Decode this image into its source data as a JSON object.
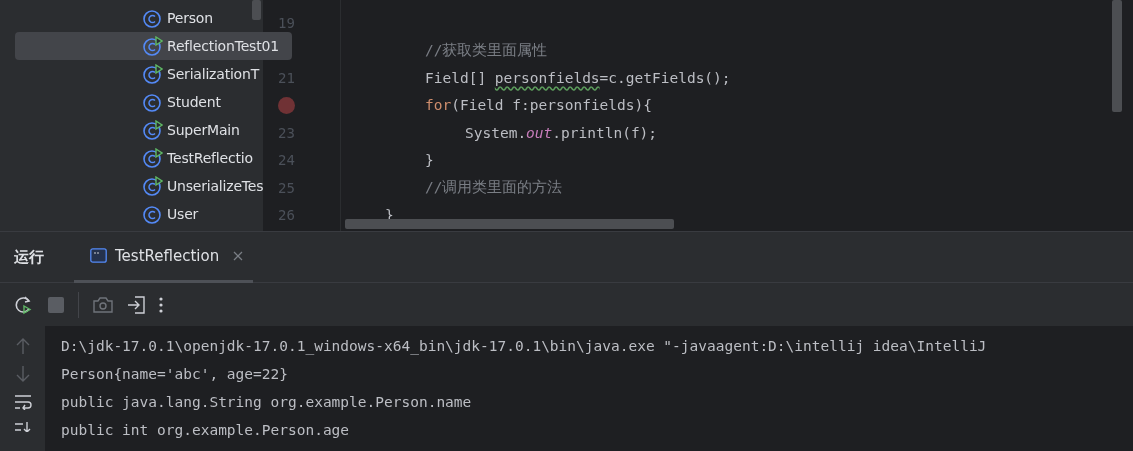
{
  "project_tree": {
    "items": [
      {
        "label": "Person",
        "kind": "class",
        "selected": false
      },
      {
        "label": "ReflectionTest01",
        "kind": "runnable",
        "selected": true
      },
      {
        "label": "SerializationT",
        "kind": "runnable",
        "selected": false
      },
      {
        "label": "Student",
        "kind": "class",
        "selected": false
      },
      {
        "label": "SuperMain",
        "kind": "runnable",
        "selected": false
      },
      {
        "label": "TestReflectio",
        "kind": "runnable",
        "selected": false
      },
      {
        "label": "UnserializeTes",
        "kind": "runnable",
        "selected": false
      },
      {
        "label": "User",
        "kind": "class",
        "selected": false
      }
    ]
  },
  "editor": {
    "lines": [
      {
        "number": "19"
      },
      {
        "tokens": [
          {
            "text": "//获取类里面属性",
            "kind": "comment"
          }
        ]
      },
      {
        "number": "21",
        "tokens": [
          {
            "text": "Field[] ",
            "kind": "plain"
          },
          {
            "text": "personfields",
            "kind": "warn"
          },
          {
            "text": "=c.getFields();",
            "kind": "plain"
          }
        ]
      },
      {
        "breakpoint": true,
        "tokens": [
          {
            "text": "for",
            "kind": "keyword"
          },
          {
            "text": "(Field f:personfields){",
            "kind": "plain"
          }
        ]
      },
      {
        "number": "23",
        "indent": true,
        "tokens": [
          {
            "text": "System.",
            "kind": "plain"
          },
          {
            "text": "out",
            "kind": "field"
          },
          {
            "text": ".println(f);",
            "kind": "plain"
          }
        ]
      },
      {
        "number": "24",
        "tokens": [
          {
            "text": "}",
            "kind": "plain"
          }
        ]
      },
      {
        "number": "25",
        "tokens": [
          {
            "text": "//调用类里面的方法",
            "kind": "comment"
          }
        ]
      },
      {
        "number": "26",
        "outer": true,
        "tokens": [
          {
            "text": "}",
            "kind": "plain"
          }
        ]
      }
    ]
  },
  "run_panel": {
    "title": "运行",
    "tabs": [
      {
        "label": "TestReflection",
        "selected": true
      }
    ],
    "toolbar": [
      {
        "kind": "rerun",
        "disabled": false
      },
      {
        "kind": "stop",
        "disabled": true
      },
      {
        "kind": "separator"
      },
      {
        "kind": "camera",
        "disabled": true
      },
      {
        "kind": "exit",
        "disabled": false
      },
      {
        "kind": "more",
        "disabled": false
      }
    ],
    "console": [
      "D:\\jdk-17.0.1\\openjdk-17.0.1_windows-x64_bin\\jdk-17.0.1\\bin\\java.exe \"-javaagent:D:\\intellij idea\\IntelliJ",
      "Person{name='abc', age=22}",
      "public java.lang.String org.example.Person.name",
      "public int org.example.Person.age"
    ]
  }
}
